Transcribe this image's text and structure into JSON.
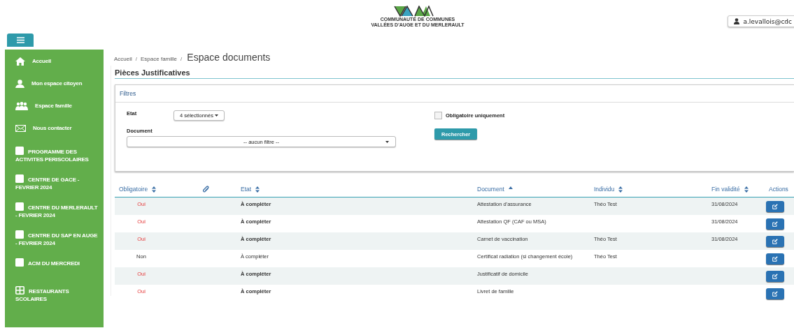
{
  "header": {
    "logo_lines": [
      "COMMUNAUTÉ DE COMMUNES",
      "VALLÉES D'AUGE ET DU MERLERAULT"
    ],
    "user": "a.levallois@cdc"
  },
  "sidebar": {
    "items": [
      {
        "label": "Accueil",
        "kind": "link"
      },
      {
        "label": "Mon espace citoyen",
        "kind": "link"
      },
      {
        "label": "Espace famille",
        "kind": "link"
      },
      {
        "label": "Nous contacter",
        "kind": "link"
      },
      {
        "label": "PROGRAMME DES ACTIVITES PERISCOLAIRES",
        "kind": "activity"
      },
      {
        "label": "CENTRE DE GACE - FEVRIER 2024",
        "kind": "activity"
      },
      {
        "label": "CENTRE DU MERLERAULT - FEVRIER 2024",
        "kind": "activity"
      },
      {
        "label": "CENTRE DU SAP EN AUGE - FEVRIER 2024",
        "kind": "activity"
      },
      {
        "label": "ACM DU MERCREDI",
        "kind": "activity"
      },
      {
        "label": "RESTAURANTS SCOLAIRES",
        "kind": "grid"
      }
    ]
  },
  "breadcrumb": [
    {
      "label": "Accueil",
      "separator": "/"
    },
    {
      "label": "Espace famille",
      "separator": "/"
    }
  ],
  "page_title": "Espace documents",
  "panel_title": "Pièces Justificatives",
  "filters": {
    "title": "Filtres",
    "etat_label": "Etat",
    "etat_value": "4 sélectionnés",
    "document_label": "Document",
    "document_value": "-- aucun filtre --",
    "required_only": {
      "label": "Obligatoire uniquement",
      "checked": false
    },
    "search_button": "Rechercher"
  },
  "table": {
    "columns": [
      {
        "label": "Obligatoire",
        "sorted": false
      },
      {
        "kind": "attachment"
      },
      {
        "label": "Etat",
        "sorted": false
      },
      {
        "label": "Document",
        "sorted": true
      },
      {
        "label": "Individu",
        "sorted": false
      },
      {
        "label": "Fin validité",
        "sorted": false
      },
      {
        "label": "Actions"
      }
    ],
    "rows": [
      {
        "obligatoire": "Oui",
        "required": true,
        "etat": "À compléter",
        "document": "Attestation d'assurance",
        "individu": "Théo Test",
        "fin": "31/08/2024"
      },
      {
        "obligatoire": "Oui",
        "required": true,
        "etat": "À compléter",
        "document": "Attestation QF (CAF ou MSA)",
        "fin": "31/08/2024"
      },
      {
        "obligatoire": "Oui",
        "required": true,
        "etat": "À compléter",
        "document": "Carnet de vaccination",
        "individu": "Théo Test",
        "fin": "31/08/2024"
      },
      {
        "obligatoire": "Non",
        "required": false,
        "etat": "À compléter",
        "document": "Certificat radiation (si changement école)",
        "individu": "Théo Test"
      },
      {
        "obligatoire": "Oui",
        "required": true,
        "etat": "À compléter",
        "document": "Justificatif de domicile"
      },
      {
        "obligatoire": "Oui",
        "required": true,
        "etat": "À compléter",
        "document": "Livret de famille"
      }
    ]
  }
}
